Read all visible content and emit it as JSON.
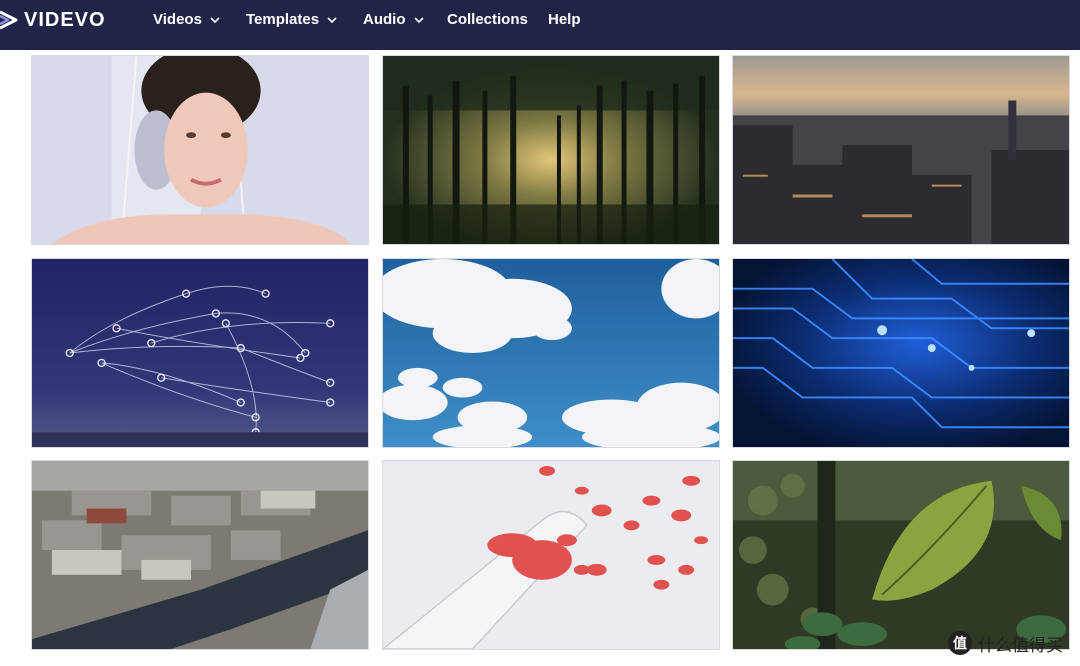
{
  "brand": {
    "name": "VIDEVO",
    "navbar_color": "#222447"
  },
  "nav": {
    "videos": "Videos",
    "templates": "Templates",
    "audio": "Audio",
    "collections": "Collections",
    "help": "Help"
  },
  "watermark": {
    "glyph": "值",
    "text": "什么值得买"
  }
}
